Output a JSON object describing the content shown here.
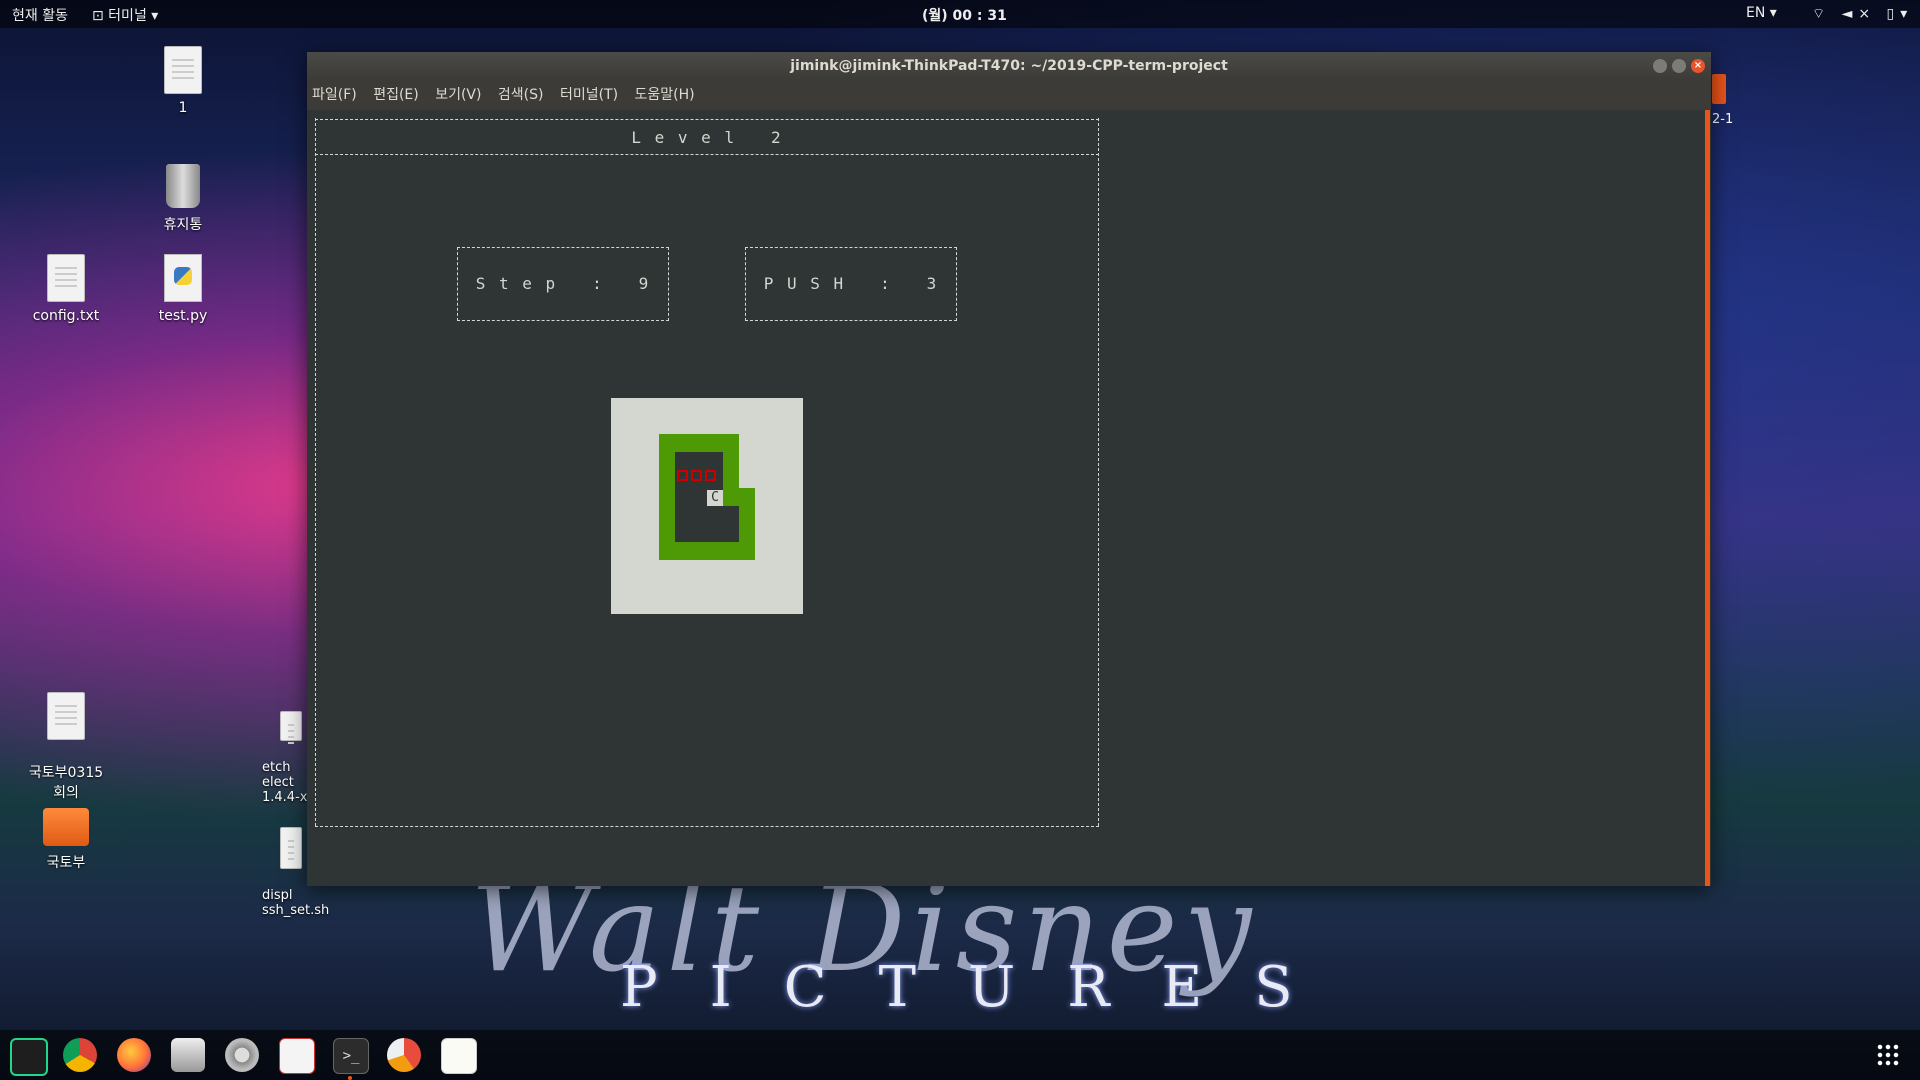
{
  "topbar": {
    "activities": "현재 활동",
    "app_menu": "⊡ 터미널 ▾",
    "clock": "(월) 00 : 31",
    "lang": "EN ▾",
    "tray": "⌔ ◄× ▯▾"
  },
  "desktop": {
    "icons": [
      {
        "label": "1",
        "icon": "file-icon"
      },
      {
        "label": "휴지통",
        "icon": "trash-icon"
      },
      {
        "label": "config.txt",
        "icon": "file-icon"
      },
      {
        "label": "test.py",
        "icon": "python-file-icon"
      },
      {
        "label": "국토부0315\n회의",
        "icon": "file-icon"
      },
      {
        "label": "국토부",
        "icon": "folder-icon"
      },
      {
        "label": "etch\nelect\n1.4.4-x",
        "icon": "file-icon"
      },
      {
        "label": "displ\nssh_set.sh",
        "icon": "file-icon"
      }
    ],
    "side_label": "2-1",
    "wallpaper_pictures": "PICTURES",
    "wallpaper_disney": "Walt Disney"
  },
  "window": {
    "title": "jimink@jimink-ThinkPad-T470: ~/2019-CPP-term-project",
    "menu": [
      "파일(F)",
      "편집(E)",
      "보기(V)",
      "검색(S)",
      "터미널(T)",
      "도움말(H)"
    ]
  },
  "game": {
    "level_text": "L e v e l   2",
    "step_text": "S t e p   :   9",
    "push_text": "P U S H   :   3",
    "level": 2,
    "step": 9,
    "push": 3,
    "character": "C"
  },
  "colors": {
    "terminal_bg": "#2f3435",
    "wall": "#4e9a06",
    "goal": "#cc0000",
    "accent": "#e9541a"
  }
}
